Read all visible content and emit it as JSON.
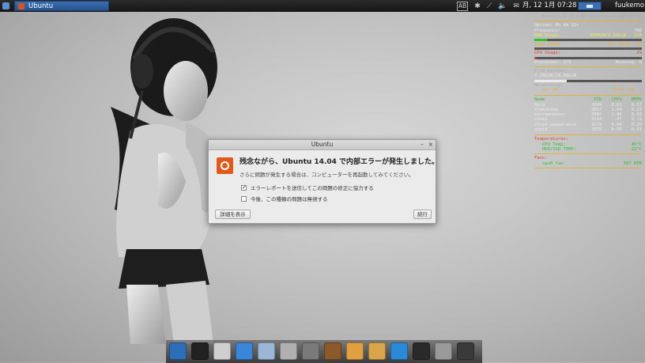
{
  "top_panel": {
    "task_title": "Ubuntu",
    "tray_keyboard": "AB",
    "clock": "月, 12 1月 07:28",
    "username": "fuukemo"
  },
  "conky": {
    "kernel": "Kernel: 3.13.0-43-generic on x86_64",
    "uptime_label": "Uptime:",
    "uptime_value": "0h 4m 12s",
    "frequency_label": "Frequency:",
    "frequency_value": "780",
    "ram_label": "RAM Usage:",
    "ram_value": "460MiB/3.64GiB - 12%",
    "swap_label": "Swap Usage:",
    "swap_value": "0B/ 4GiB - 0%",
    "cpu_label": "CPU Usage:",
    "cpu_value": "2%",
    "processes_label": "Processes:",
    "processes_value": "179",
    "running_label": "Running:",
    "running_value": "0",
    "file_section": "File systems:",
    "fs_value": "7.23GiB/24.58GiB",
    "networking": "Networking:",
    "net_up_label": "Up:",
    "net_up_value": "0B",
    "net_down_label": "Down:",
    "net_down_value": "0B",
    "proc_header": [
      "Name",
      "PID",
      "CPU%",
      "MEM%"
    ],
    "proc_rows": [
      [
        "Xorg",
        "3604",
        "0.62",
        "0.57"
      ],
      [
        "xfdesktop",
        "3857",
        "2.04",
        "3.23"
      ],
      [
        "xscreensaver",
        "3902",
        "1.96",
        "0.83"
      ],
      [
        "conky",
        "4114",
        ".47",
        "0.11"
      ],
      [
        "xfce4-appearance",
        "4178",
        "0.90",
        "0.20"
      ],
      [
        "acpid",
        "1035",
        "0.90",
        "0.01"
      ]
    ],
    "temp_header": "Temperatures:",
    "temp_rows": [
      [
        "CPU Temp:",
        "45°C"
      ],
      [
        "HDD/SSD TEMP:",
        "22°C"
      ]
    ],
    "fan_header": "Fans:",
    "fan_row": [
      "cpu0 fan:",
      "567 RPM"
    ]
  },
  "dialog": {
    "title": "Ubuntu",
    "heading": "残念ながら、Ubuntu 14.04 で内部エラーが発生しました。",
    "subtext": "さらに問題が発生する場合は、コンピューターを再起動してみてください。",
    "check1": "エラーレポートを送信してこの問題の修正に協力する",
    "check2": "今後、この種類の問題は無視する",
    "details_button": "詳細を表示",
    "continue_button": "続行",
    "check1_checked": true,
    "check2_checked": false
  },
  "dock": {
    "icons": [
      "xfce-settings-icon",
      "terminal-icon",
      "file-manager-icon",
      "browser-icon",
      "image-viewer-icon",
      "mixer-icon",
      "search-icon",
      "speaker-icon",
      "paint-icon",
      "folder-icon",
      "update-icon",
      "clock-icon",
      "trash-icon",
      "power-icon"
    ],
    "colors": [
      "#2c6fb8",
      "#222222",
      "#cfcfcf",
      "#3a86d8",
      "#9bb6d6",
      "#b0b0b0",
      "#7a7a7a",
      "#8a5a2a",
      "#e0a040",
      "#d9a54a",
      "#2a8ad8",
      "#2a2a2a",
      "#9a9a9a",
      "#3a3a3a"
    ]
  }
}
